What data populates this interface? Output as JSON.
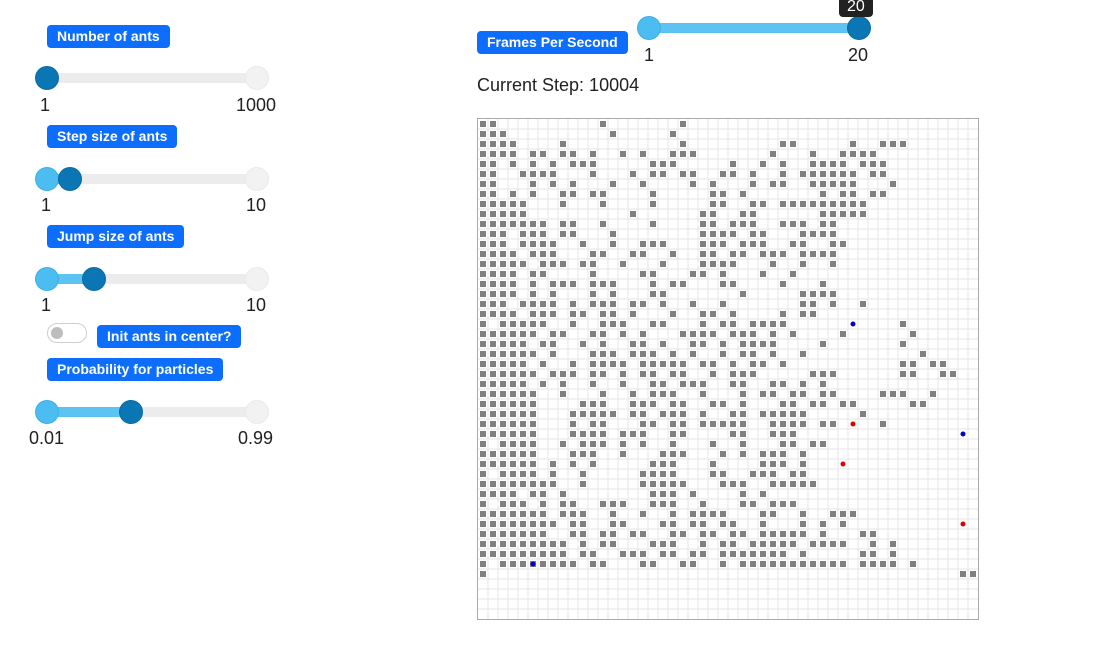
{
  "controls": {
    "num_ants": {
      "label": "Number of ants",
      "min_label": "1",
      "max_label": "1000",
      "value": 1,
      "min": 1,
      "max": 1000
    },
    "step_size": {
      "label": "Step size of ants",
      "min_label": "1",
      "max_label": "10",
      "value": 2,
      "min": 1,
      "max": 10
    },
    "jump_size": {
      "label": "Jump size of ants",
      "min_label": "1",
      "max_label": "10",
      "value": 3,
      "min": 1,
      "max": 10
    },
    "init_center": {
      "label": "Init ants in center?",
      "checked": false
    },
    "probability": {
      "label": "Probability for particles",
      "min_label": "0.01",
      "max_label": "0.99",
      "value": 0.4,
      "min": 0.01,
      "max": 0.99
    }
  },
  "fps": {
    "label": "Frames Per Second",
    "min_label": "1",
    "max_label": "20",
    "value": 20,
    "tooltip": "20"
  },
  "status": {
    "current_step": "Current Step: 10004"
  },
  "colors": {
    "accent": "#0d6efd",
    "handle": "#0b76b4",
    "fill": "#5cc4f2",
    "particle": "#808080",
    "ant_blue": "#0000cc",
    "ant_red": "#dd0000"
  },
  "grid": {
    "cols": 50,
    "rows": 50,
    "pattern": [
      "##..........#.......#...............................",
      "###..........#.....#................................",
      "####....#...........#.........##.....#..###.........",
      "####.##.##.#..#.#..###.......#...#..####..........",
      "##.#.#.#.###.....###.....#..#.#..####.###.........",
      "##..####...#...#.##.##..##.#..#.######.##..........",
      "##...#.#.#...#..#....#.#...#.##..#####...#........",
      "##.#.#..##.##....#.....##.#.......#.##.##..........",
      "#####...#...#....#.....##..##.#########...........",
      "#####..........#......##..##......#####...........",
      "#######.##..#....#....##.###..###.##..............",
      "###.###.##...#........####.##...####..............",
      "###.####..#..#..###...###.###..##..##.............",
      "####.###...##..##..#..##.##.###.####..............",
      "#####.###.##..#...#...####...#..#..#..............",
      "####.##....#....##...##.#...#..#..................",
      "####.#.###.###...#.##...##....#...#...............",
      "####.#.#...#.#...##.......#.....####..............",
      "###.####.#.###.##.#..#..#.......##.#..#...........",
      "####.###.##.##.#...#..##.#....#.##................",
      "#.#####..#..###..##...#.##.####...........#.......",
      "######.##..##.#.#...####.###.#.#....#......#......",
      "#####.##..#.#..##.#..##.#.####....#.......#.......",
      "######.#...###.###.#.#..#.##.#..#...........#.....",
      "#####.#..#.####.#####.##.#.##.#...........##.##...",
      "######.###.##.#.##.##..#.###.....###......##..##..",
      "#####.#.#..#..#..##.###..##..##.#.#...............",
      "######..#...#..#.###..#...#.##.##.##....###..#....",
      "######....###..###.##..##.#...##.##.##.....##.....",
      "######...#####.##.###.#..##.#####.....#...........",
      "######...#.##...##.##.#####..####.##....#.........",
      "######...####.###..##....##..###..................",
      "#.####..#.###.#.#..#...#..#...##.##...............",
      "######...###..#...###...#.#.###.#.................",
      "######.#.#.#.....###...#....###.#.................",
      "#.####.#..#.....####...##..###.##.................",
      "########..#.....#####...###..#####................",
      "####.##.#........###.#....#.#.....................",
      "#.###.#.##..###..###..#...##.###..................",
      "#######.###..#..#..#.####...##..#..###............",
      "########.##..##...##.##.##..#...#.#.#.............",
      "#######..##.##.##..##.##.##.#####.#...##..........",
      "#########.#.##...###..#.##.#####.####..#.#........",
      "#########.##..###.##.##.#######.#.....##.#........",
      "#.########.##...##..##..#.###########.####.#......",
      "#...............................................##"
    ],
    "ants": [
      {
        "col": 37,
        "row": 20,
        "color": "blue"
      },
      {
        "col": 37,
        "row": 30,
        "color": "red"
      },
      {
        "col": 48,
        "row": 31,
        "color": "blue"
      },
      {
        "col": 36,
        "row": 34,
        "color": "red"
      },
      {
        "col": 48,
        "row": 40,
        "color": "red"
      },
      {
        "col": 5,
        "row": 44,
        "color": "blue"
      }
    ]
  }
}
